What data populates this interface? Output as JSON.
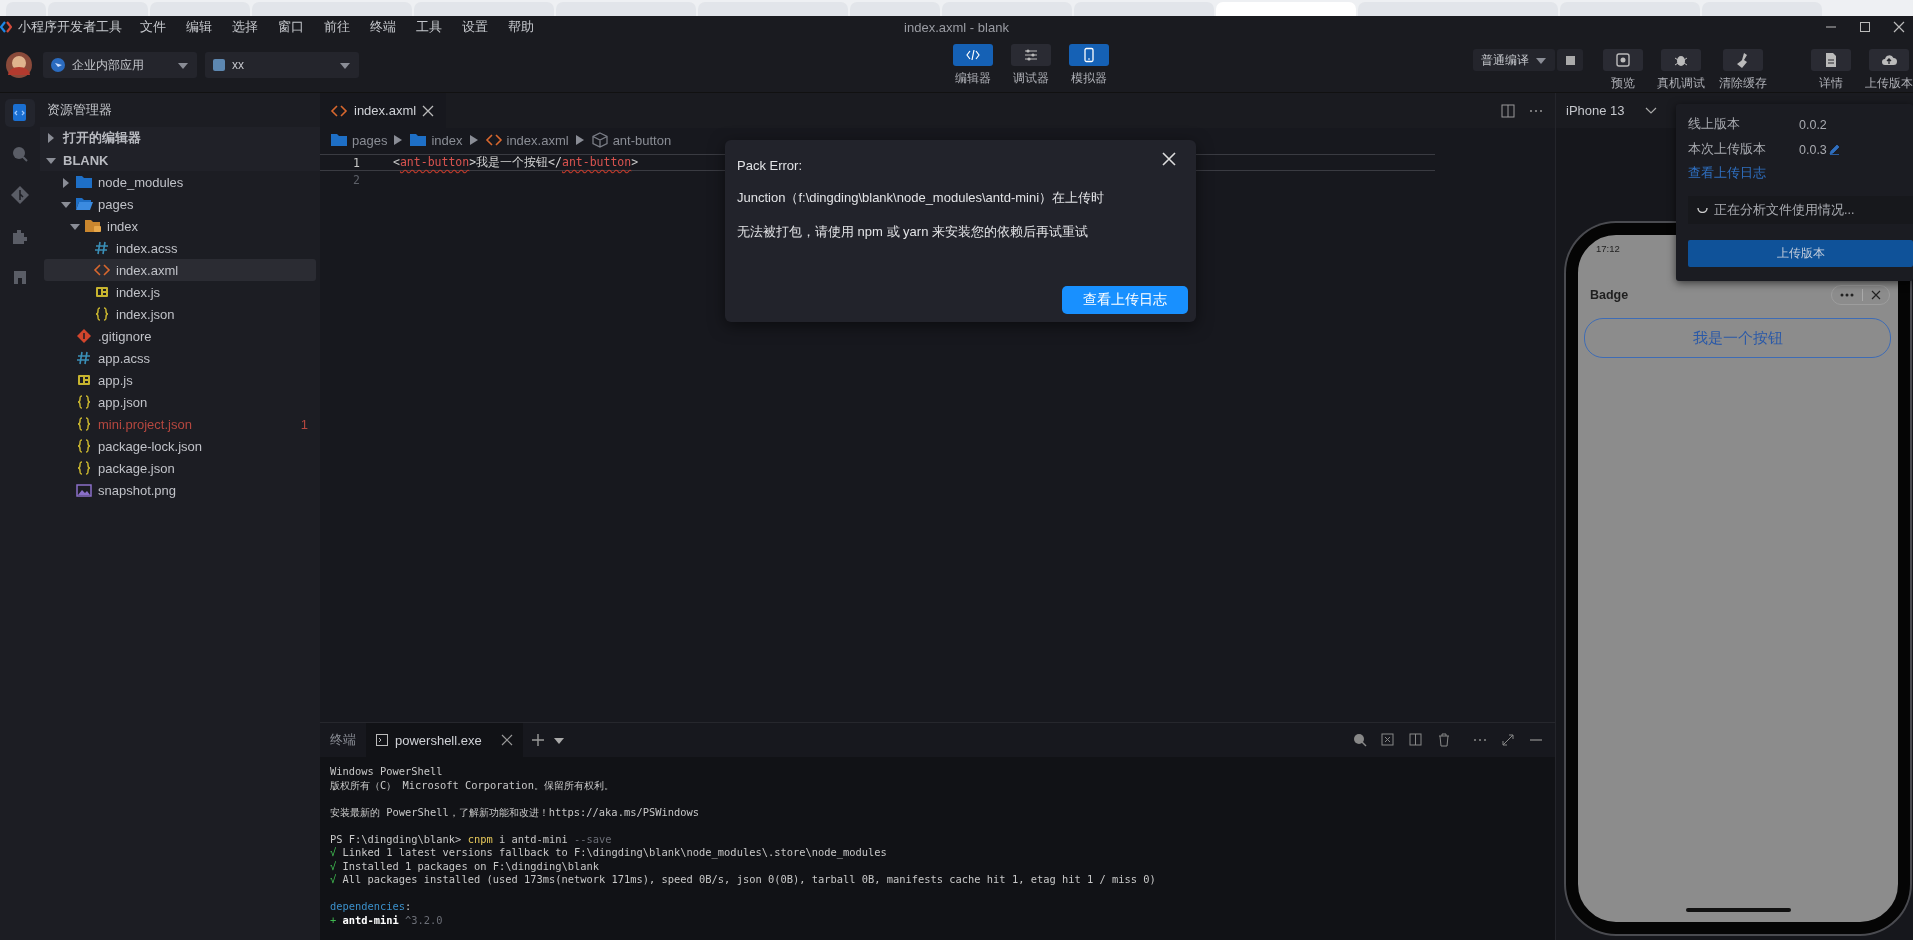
{
  "title_bar": {
    "app_name": "小程序开发者工具",
    "menu": [
      "文件",
      "编辑",
      "选择",
      "窗口",
      "前往",
      "终端",
      "工具",
      "设置",
      "帮助"
    ],
    "title": "index.axml - blank"
  },
  "toolbar": {
    "org_select": "企业内部应用",
    "project_select": "xx",
    "modes": [
      {
        "label": "编辑器",
        "kind": "code",
        "selected": true
      },
      {
        "label": "调试器",
        "kind": "sliders",
        "selected": false
      },
      {
        "label": "模拟器",
        "kind": "phone",
        "selected": true
      }
    ],
    "compile_select": "普通编译",
    "actions": [
      {
        "label": "预览",
        "kind": "preview"
      },
      {
        "label": "真机调试",
        "kind": "bug"
      },
      {
        "label": "清除缓存",
        "kind": "broom"
      },
      {
        "label": "详情",
        "kind": "doc"
      },
      {
        "label": "上传版本",
        "kind": "upload"
      }
    ]
  },
  "activity_bar": [
    {
      "kind": "files",
      "selected": true
    },
    {
      "kind": "search",
      "selected": false
    },
    {
      "kind": "git",
      "selected": false
    },
    {
      "kind": "extensions",
      "selected": false
    },
    {
      "kind": "remote",
      "selected": false
    }
  ],
  "explorer": {
    "title": "资源管理器",
    "sections": [
      {
        "label": "打开的编辑器",
        "expanded": false
      },
      {
        "label": "BLANK",
        "expanded": true
      }
    ],
    "tree": [
      {
        "name": "node_modules",
        "kind": "folder",
        "expanded": false,
        "selected": false,
        "error": false
      },
      {
        "name": "pages",
        "kind": "folder",
        "expanded": true,
        "selected": false,
        "error": false,
        "children": [
          {
            "name": "index",
            "kind": "page-folder",
            "expanded": true,
            "selected": false,
            "error": false,
            "children": [
              {
                "name": "index.acss",
                "kind": "acss",
                "selected": false,
                "error": false
              },
              {
                "name": "index.axml",
                "kind": "axml",
                "selected": true,
                "error": false
              },
              {
                "name": "index.js",
                "kind": "js",
                "selected": false,
                "error": false
              },
              {
                "name": "index.json",
                "kind": "json",
                "selected": false,
                "error": false
              }
            ]
          }
        ]
      },
      {
        "name": ".gitignore",
        "kind": "git",
        "selected": false,
        "error": false
      },
      {
        "name": "app.acss",
        "kind": "acss",
        "selected": false,
        "error": false
      },
      {
        "name": "app.js",
        "kind": "js",
        "selected": false,
        "error": false
      },
      {
        "name": "app.json",
        "kind": "json",
        "selected": false,
        "error": false
      },
      {
        "name": "mini.project.json",
        "kind": "json",
        "selected": false,
        "error": true,
        "problems": "1"
      },
      {
        "name": "package-lock.json",
        "kind": "json",
        "selected": false,
        "error": false
      },
      {
        "name": "package.json",
        "kind": "json",
        "selected": false,
        "error": false
      },
      {
        "name": "snapshot.png",
        "kind": "image",
        "selected": false,
        "error": false
      }
    ]
  },
  "editor": {
    "tabs": [
      {
        "label": "index.axml",
        "selected": true
      }
    ],
    "breadcrumbs": [
      {
        "label": "pages",
        "kind": "folder"
      },
      {
        "label": "index",
        "kind": "folder"
      },
      {
        "label": "index.axml",
        "kind": "axml"
      },
      {
        "label": "ant-button",
        "kind": "element"
      }
    ],
    "lines": [
      {
        "number": "1",
        "current": true,
        "tokens": [
          {
            "text": "<",
            "kind": "punct"
          },
          {
            "text": "ant-button",
            "kind": "tag"
          },
          {
            "text": ">我是一个按钮</",
            "kind": "text"
          },
          {
            "text": "ant-button",
            "kind": "tag"
          },
          {
            "text": ">",
            "kind": "punct"
          }
        ]
      },
      {
        "number": "2",
        "current": false
      }
    ]
  },
  "terminal": {
    "tabs": [
      {
        "label": "终端",
        "kind": "panel",
        "selected": false
      },
      {
        "label": "powershell.exe",
        "kind": "shell",
        "selected": true
      }
    ],
    "lines": [
      {
        "gap_before": false,
        "tokens": [
          {
            "text": "Windows PowerShell",
            "kind": "plain"
          }
        ]
      },
      {
        "gap_before": false,
        "tokens": [
          {
            "text": "版权所有（C） Microsoft Corporation。保留所有权利。",
            "kind": "plain"
          }
        ]
      },
      {
        "gap_before": true,
        "tokens": [
          {
            "text": "安装最新的 PowerShell，了解新功能和改进！https://aka.ms/PSWindows",
            "kind": "plain"
          }
        ]
      },
      {
        "gap_before": true,
        "tokens": [
          {
            "text": "PS F:\\dingding\\blank> ",
            "kind": "plain"
          },
          {
            "text": "cnpm",
            "kind": "command"
          },
          {
            "text": " i antd-mini ",
            "kind": "plain"
          },
          {
            "text": "--save",
            "kind": "muted"
          }
        ]
      },
      {
        "gap_before": false,
        "tokens": [
          {
            "text": "√",
            "kind": "ok"
          },
          {
            "text": " Linked 1 latest versions fallback to F:\\dingding\\blank\\node_modules\\.store\\node_modules",
            "kind": "plain"
          }
        ]
      },
      {
        "gap_before": false,
        "tokens": [
          {
            "text": "√",
            "kind": "ok"
          },
          {
            "text": " Installed 1 packages on F:\\dingding\\blank",
            "kind": "plain"
          }
        ]
      },
      {
        "gap_before": false,
        "tokens": [
          {
            "text": "√",
            "kind": "ok"
          },
          {
            "text": " All packages installed (used 173ms(network 171ms), speed 0B/s, json 0(0B), tarball 0B, manifests cache hit 1, etag hit 1 / miss 0)",
            "kind": "plain"
          }
        ]
      },
      {
        "gap_before": true,
        "tokens": [
          {
            "text": "dependencies",
            "kind": "key"
          },
          {
            "text": ":",
            "kind": "plain"
          }
        ]
      },
      {
        "gap_before": false,
        "tokens": [
          {
            "text": "+ ",
            "kind": "ok"
          },
          {
            "text": "antd-mini",
            "kind": "strong"
          },
          {
            "text": " ^3.2.0",
            "kind": "muted"
          }
        ]
      }
    ]
  },
  "simulator": {
    "device": "iPhone 13",
    "status_time": "17:12",
    "page_title": "Badge",
    "button_label": "我是一个按钮"
  },
  "upload_panel": {
    "online_label": "线上版本",
    "online_version": "0.0.2",
    "upload_label": "本次上传版本",
    "upload_version": "0.0.3",
    "log_link": "查看上传日志",
    "status": "正在分析文件使用情况...",
    "upload_button": "上传版本"
  },
  "dialog": {
    "title": "Pack Error:",
    "lines": [
      "Junction（f:\\dingding\\blank\\node_modules\\antd-mini）在上传时",
      "无法被打包，请使用 npm 或 yarn 来安装您的依赖后再试重试"
    ],
    "button": "查看上传日志"
  }
}
